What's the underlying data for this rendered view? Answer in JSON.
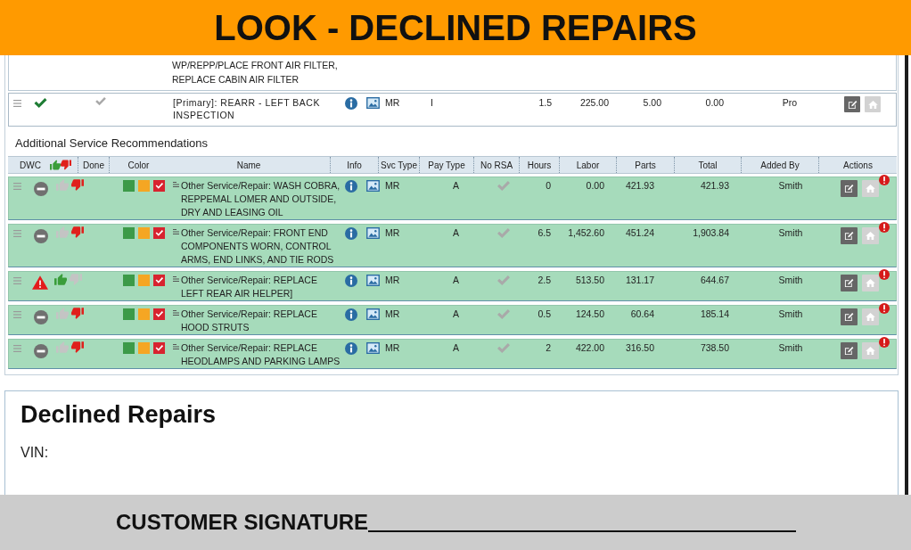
{
  "banner": {
    "title": "LOOK - DECLINED REPAIRS"
  },
  "services": {
    "continued_row": {
      "name": "WP/REPP/PLACE FRONT AIR FILTER, REPLACE CABIN AIR FILTER"
    },
    "primary_row": {
      "approved": true,
      "done": false,
      "name": "[Primary]: REARR - LEFT BACK INSPECTION",
      "svc_type": "MR",
      "pay_type": "I",
      "hours": "1.5",
      "labor": "225.00",
      "parts": "5.00",
      "total": "0.00",
      "added_by": "Pro",
      "home_enabled": false
    }
  },
  "recommendations": {
    "title": "Additional Service Recommendations",
    "columns": [
      "DWC",
      "Done",
      "Color",
      "Name",
      "Info",
      "Svc Type",
      "Pay Type",
      "No RSA",
      "Hours",
      "Labor",
      "Parts",
      "Total",
      "Added By",
      "Actions"
    ],
    "rows": [
      {
        "warning": false,
        "thumbs_up": false,
        "thumbs_down": true,
        "colors": [
          {
            "color": "#3c9a48",
            "selected": false
          },
          {
            "color": "#f5a623",
            "selected": false
          },
          {
            "color": "#d8232f",
            "selected": true
          }
        ],
        "name": "Other Service/Repair: WASH COBRA, REPPEMAL LOMER AND OUTSIDE, DRY AND LEASING OIL",
        "svc_type": "MR",
        "pay_type": "A",
        "no_rsa": false,
        "hours": "0",
        "labor": "0.00",
        "parts": "421.93",
        "total": "421.93",
        "added_by": "Smith",
        "home_enabled": false,
        "alert": true
      },
      {
        "warning": false,
        "thumbs_up": false,
        "thumbs_down": true,
        "colors": [
          {
            "color": "#3c9a48",
            "selected": false
          },
          {
            "color": "#f5a623",
            "selected": false
          },
          {
            "color": "#d8232f",
            "selected": true
          }
        ],
        "name": "Other Service/Repair: FRONT END COMPONENTS WORN, CONTROL ARMS, END LINKS, AND TIE RODS",
        "svc_type": "MR",
        "pay_type": "A",
        "no_rsa": false,
        "hours": "6.5",
        "labor": "1,452.60",
        "parts": "451.24",
        "total": "1,903.84",
        "added_by": "Smith",
        "home_enabled": false,
        "alert": true
      },
      {
        "warning": true,
        "thumbs_up": true,
        "thumbs_down": false,
        "colors": [
          {
            "color": "#3c9a48",
            "selected": false
          },
          {
            "color": "#f5a623",
            "selected": false
          },
          {
            "color": "#d8232f",
            "selected": true
          }
        ],
        "name": "Other Service/Repair: REPLACE LEFT REAR AIR HELPER]",
        "svc_type": "MR",
        "pay_type": "A",
        "no_rsa": false,
        "hours": "2.5",
        "labor": "513.50",
        "parts": "131.17",
        "total": "644.67",
        "added_by": "Smith",
        "home_enabled": false,
        "alert": true
      },
      {
        "warning": false,
        "thumbs_up": false,
        "thumbs_down": true,
        "colors": [
          {
            "color": "#3c9a48",
            "selected": false
          },
          {
            "color": "#f5a623",
            "selected": false
          },
          {
            "color": "#d8232f",
            "selected": true
          }
        ],
        "name": "Other Service/Repair: REPLACE HOOD STRUTS",
        "svc_type": "MR",
        "pay_type": "A",
        "no_rsa": false,
        "hours": "0.5",
        "labor": "124.50",
        "parts": "60.64",
        "total": "185.14",
        "added_by": "Smith",
        "home_enabled": false,
        "alert": true
      },
      {
        "warning": false,
        "thumbs_up": false,
        "thumbs_down": true,
        "colors": [
          {
            "color": "#3c9a48",
            "selected": false
          },
          {
            "color": "#f5a623",
            "selected": false
          },
          {
            "color": "#d8232f",
            "selected": true
          }
        ],
        "name": "Other Service/Repair: REPLACE HEODLAMPS AND PARKING LAMPS",
        "svc_type": "MR",
        "pay_type": "A",
        "no_rsa": false,
        "hours": "2",
        "labor": "422.00",
        "parts": "316.50",
        "total": "738.50",
        "added_by": "Smith",
        "home_enabled": false,
        "alert": true
      }
    ]
  },
  "declined_repairs": {
    "title": "Declined Repairs",
    "vin_label": "VIN:"
  },
  "footer": {
    "label": "CUSTOMER SIGNATURE"
  }
}
